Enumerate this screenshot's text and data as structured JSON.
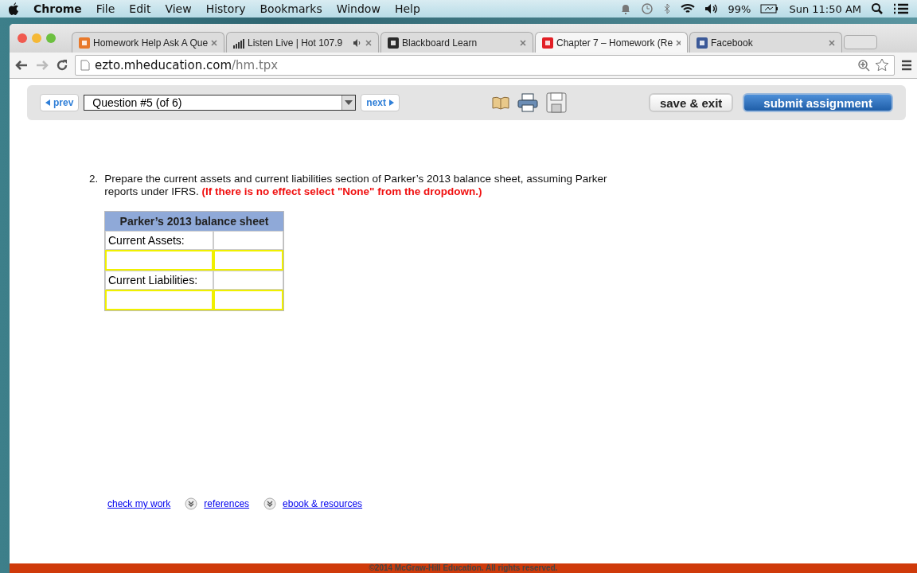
{
  "menubar": {
    "app": "Chrome",
    "items": [
      "File",
      "Edit",
      "View",
      "History",
      "Bookmarks",
      "Window",
      "Help"
    ],
    "battery": "99%",
    "clock": "Sun 11:50 AM"
  },
  "tabs": [
    {
      "label": "Homework Help Ask A Que",
      "kind": "orange",
      "selected": false,
      "audio": false
    },
    {
      "label": "Listen Live | Hot 107.9",
      "kind": "equalizer",
      "selected": false,
      "audio": true
    },
    {
      "label": "Blackboard Learn",
      "kind": "dark",
      "selected": false,
      "audio": false
    },
    {
      "label": "Chapter 7 – Homework (Re",
      "kind": "red",
      "selected": true,
      "audio": false
    },
    {
      "label": "Facebook",
      "kind": "blue",
      "selected": false,
      "audio": false
    }
  ],
  "address": {
    "host": "ezto.mheducation.com",
    "path": "/hm.tpx"
  },
  "toolbar": {
    "prev": "prev",
    "question": "Question #5 (of 6)",
    "next": "next",
    "save": "save & exit",
    "submit": "submit assignment"
  },
  "question": {
    "number": "2.",
    "text": "Prepare the current assets and current liabilities section of Parker’s 2013 balance sheet, assuming Parker reports under IFRS. **(If there is no effect select \"None\" from the dropdown.)**"
  },
  "table": {
    "title": "Parker’s 2013 balance sheet",
    "rows": [
      {
        "kind": "label",
        "label": "Current Assets:"
      },
      {
        "kind": "input"
      },
      {
        "kind": "label",
        "label": "Current Liabilities:"
      },
      {
        "kind": "input"
      }
    ]
  },
  "links": [
    {
      "label": "check my work",
      "expander": false
    },
    {
      "label": "references",
      "expander": true
    },
    {
      "label": "ebook & resources",
      "expander": true
    }
  ],
  "footer": "©2014 McGraw-Hill Education. All rights reserved."
}
